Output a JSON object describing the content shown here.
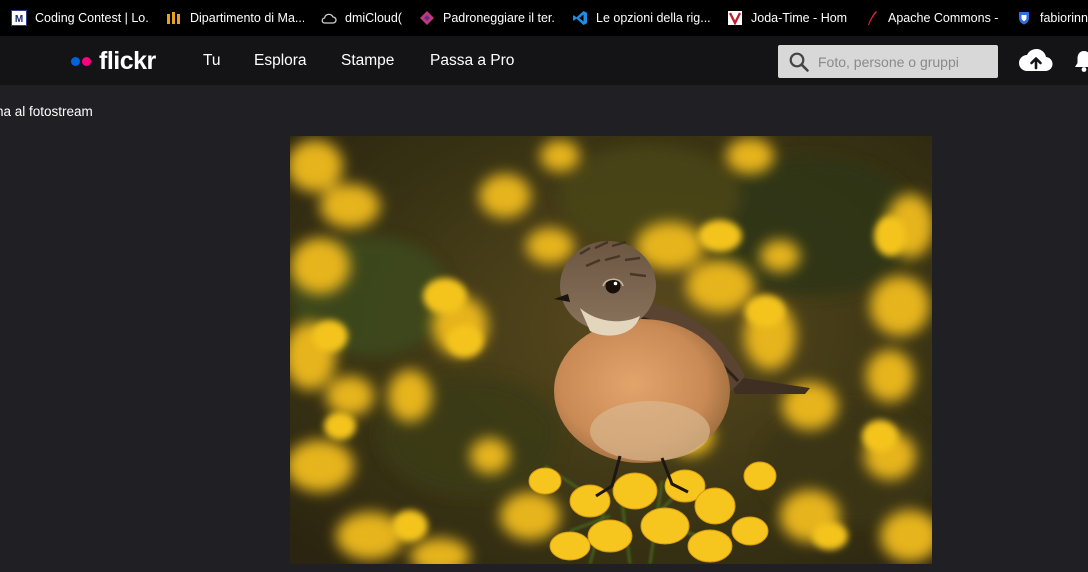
{
  "bookmarks": [
    {
      "label": "Coding Contest | Lo...",
      "icon": "coding-contest-icon"
    },
    {
      "label": "Dipartimento di Ma...",
      "icon": "dipartimento-icon"
    },
    {
      "label": "dmiCloud()",
      "icon": "cloud-icon"
    },
    {
      "label": "Padroneggiare il ter...",
      "icon": "diamond-icon"
    },
    {
      "label": "Le opzioni della rig...",
      "icon": "vscode-icon"
    },
    {
      "label": "Joda-Time - Home",
      "icon": "joda-icon"
    },
    {
      "label": "Apache Commons -...",
      "icon": "apache-feather-icon"
    },
    {
      "label": "fabiorinn",
      "icon": "shield-icon"
    }
  ],
  "header": {
    "logo_text": "flickr",
    "nav": [
      "Tu",
      "Esplora",
      "Stampe",
      "Passa a Pro"
    ],
    "search_placeholder": "Foto, persone o gruppi",
    "brand_blue": "#0063dc",
    "brand_pink": "#ff0084"
  },
  "back_link": "na al fotostream",
  "photo": {
    "subject": "stonechat-bird-on-gorse"
  }
}
